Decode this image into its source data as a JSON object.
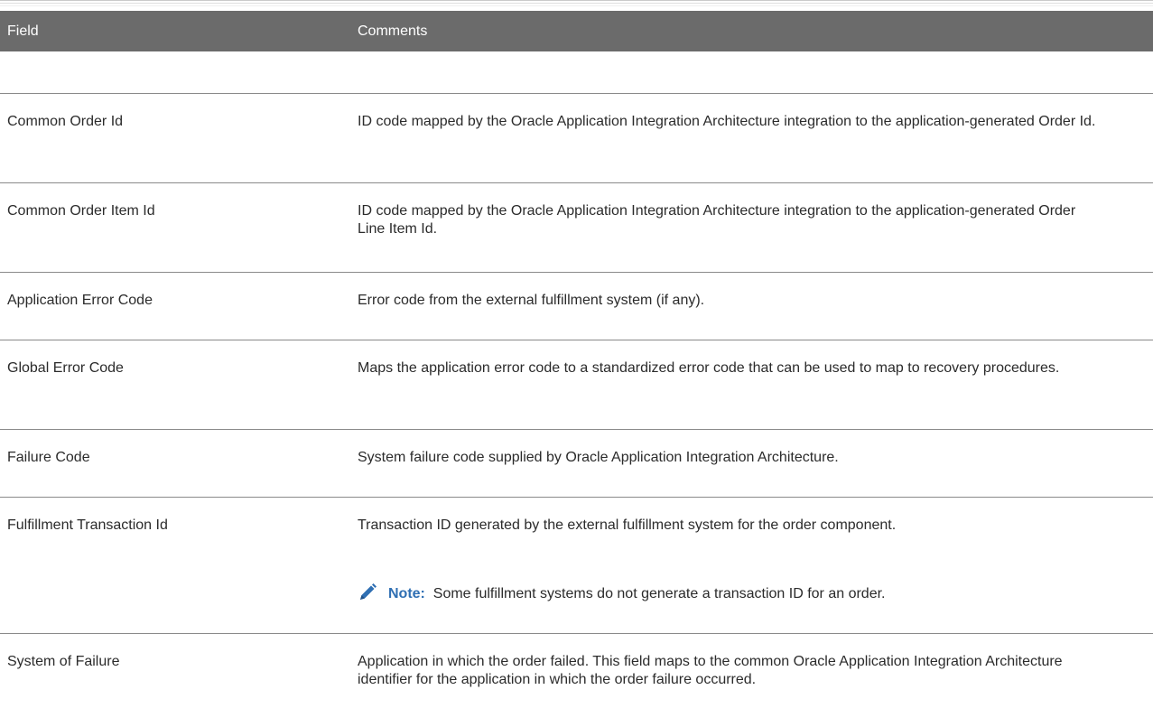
{
  "table": {
    "headers": {
      "field": "Field",
      "comments": "Comments"
    },
    "rows": [
      {
        "field": "Common Order Id",
        "comment": "ID code mapped by the Oracle Application Integration Architecture integration to the application-generated Order Id."
      },
      {
        "field": "Common Order Item Id",
        "comment": "ID code mapped by the Oracle Application Integration Architecture integration to the application-generated Order Line Item Id."
      },
      {
        "field": "Application Error Code",
        "comment": "Error code from the external fulfillment system (if any)."
      },
      {
        "field": "Global Error Code",
        "comment": "Maps the application error code to a standardized error code that can be used to map to recovery procedures."
      },
      {
        "field": "Failure Code",
        "comment": "System failure code supplied by Oracle Application Integration Architecture."
      },
      {
        "field": "Fulfillment Transaction Id",
        "comment": "Transaction ID generated by the external fulfillment system for the order component.",
        "note_label": "Note:",
        "note_text": "Some fulfillment systems do not generate a transaction ID for an order.",
        "note_icon": "pencil-icon"
      },
      {
        "field": "System of Failure",
        "comment": "Application in which the order failed. This field maps to the common Oracle Application Integration Architecture identifier for the application in which the order failure occurred."
      }
    ]
  },
  "colors": {
    "header_bg": "#6b6b6b",
    "note_accent": "#2f6fb3",
    "rule": "#8a8a8a"
  }
}
